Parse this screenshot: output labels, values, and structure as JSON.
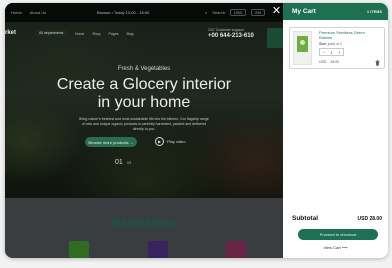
{
  "topbar": {
    "links": [
      "Home",
      "About Us"
    ],
    "promo": "Browse • Today 10:00 - 18:00",
    "search": "Search",
    "currency": "USD",
    "language": "EN"
  },
  "header": {
    "brand": "rket",
    "departments": "All departments",
    "nav": [
      "Home",
      "Shop",
      "Pages",
      "Blog"
    ],
    "phone_label": "24/7 Customer support",
    "phone_number": "+00 644-213-610"
  },
  "hero": {
    "tagline": "Fresh & Vegetables",
    "title_line1": "Create a Glocery interior",
    "title_line2": "in your home",
    "description": "Bring nature's freshest and most sustainable life into the kitchen. Our flagship range of new and unique organic products is carefully harvested, packed and delivered directly to you.",
    "cta": "Browse more products →",
    "play_label": "Play video",
    "slide_current": "01",
    "slide_total": "03"
  },
  "section": {
    "heading": "Bestsellers"
  },
  "cart": {
    "title": "My Cart",
    "count": "1 ITEMS",
    "item": {
      "name": "Premium Seedless Green Raisins",
      "size_label": "Size:",
      "size_value": "pack of 1",
      "qty_minus": "−",
      "qty": "1",
      "qty_plus": "+",
      "currency": "USD",
      "price": "28.00"
    },
    "subtotal_label": "Subtotal",
    "subtotal_value": "USD  28.00",
    "checkout": "Proceed to checkout",
    "view_cart": "View Cart  ⟶"
  },
  "colors": {
    "accent": "#1e7052"
  }
}
